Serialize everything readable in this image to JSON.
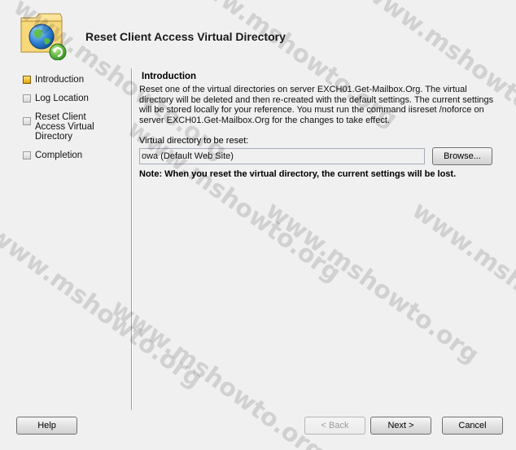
{
  "wizard": {
    "title": "Reset Client Access Virtual Directory",
    "icon": "globe-folder-reset-icon"
  },
  "steps": [
    {
      "label": "Introduction",
      "state": "active"
    },
    {
      "label": "Log Location",
      "state": "pending"
    },
    {
      "label": "Reset Client Access Virtual Directory",
      "state": "pending"
    },
    {
      "label": "Completion",
      "state": "pending"
    }
  ],
  "content": {
    "section_title": "Introduction",
    "description": "Reset one of the virtual directories on server EXCH01.Get-Mailbox.Org. The virtual directory will be deleted and then re-created with the default settings. The current settings will be stored locally for your reference. You must run the command iisreset /noforce on server EXCH01.Get-Mailbox.Org for the changes to take effect.",
    "field_label": "Virtual directory to be reset:",
    "field_value": "owa (Default Web Site)",
    "browse_label": "Browse...",
    "note": "Note: When you reset the virtual directory, the current settings will be lost."
  },
  "buttons": {
    "help": "Help",
    "back": "< Back",
    "next": "Next >",
    "cancel": "Cancel"
  },
  "watermark": "www.mshowto.org",
  "colors": {
    "background": "#f0f0f0",
    "active_step": "#e6a400"
  }
}
